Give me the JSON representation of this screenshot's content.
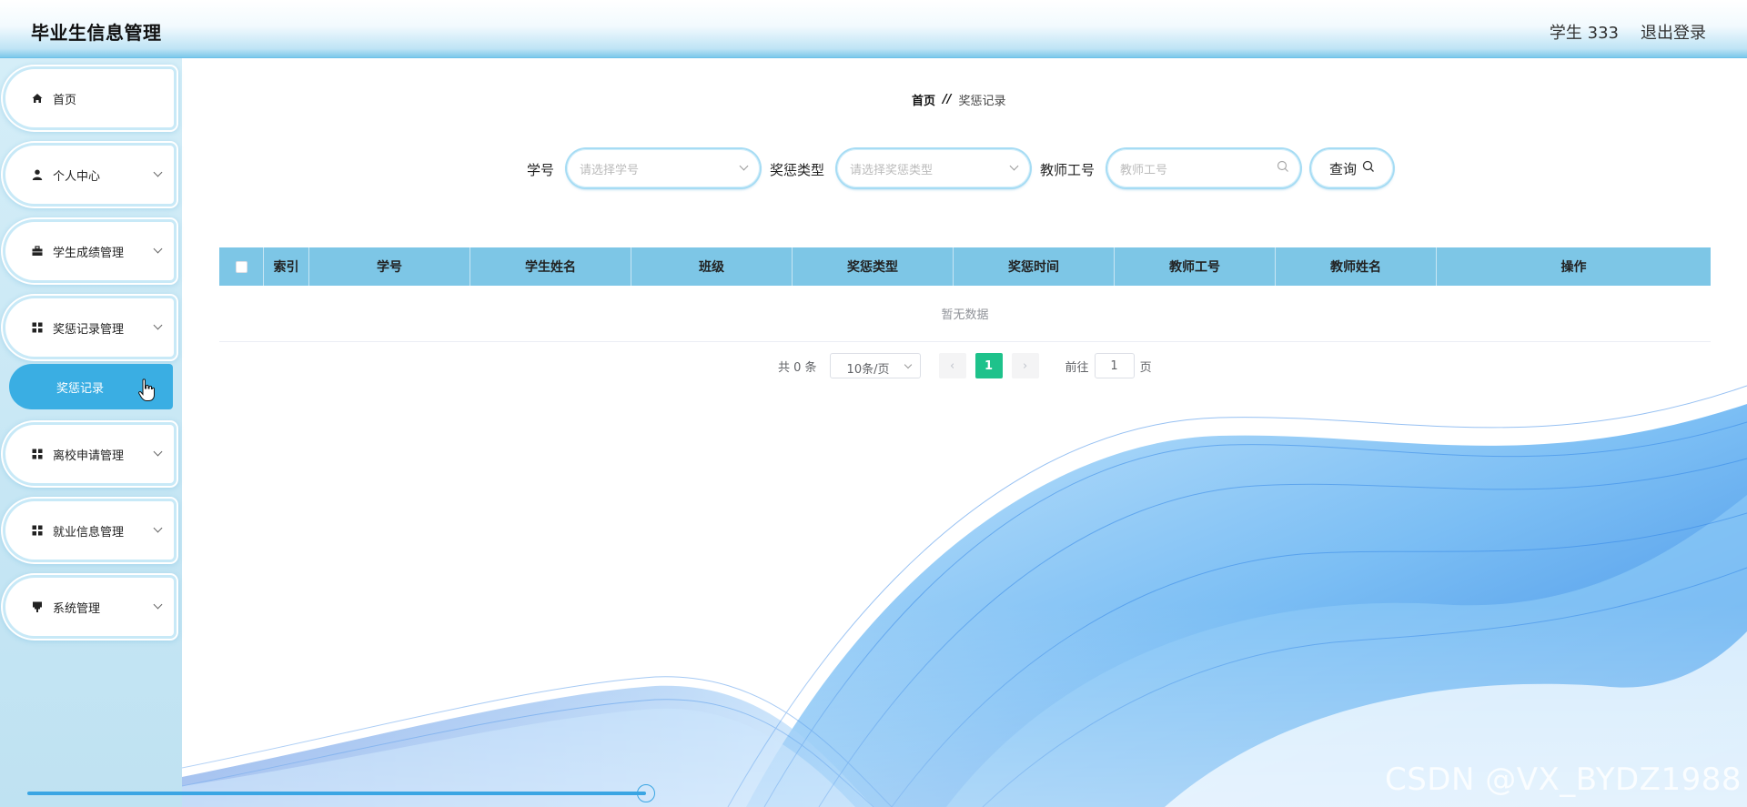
{
  "app": {
    "title": "毕业生信息管理"
  },
  "header": {
    "user_label": "学生 333",
    "logout_label": "退出登录"
  },
  "sidebar": {
    "items": [
      {
        "label": "首页",
        "icon": "home-icon"
      },
      {
        "label": "个人中心",
        "icon": "user-icon"
      },
      {
        "label": "学生成绩管理",
        "icon": "briefcase-icon"
      },
      {
        "label": "奖惩记录管理",
        "icon": "grid-icon"
      },
      {
        "label": "离校申请管理",
        "icon": "grid-icon"
      },
      {
        "label": "就业信息管理",
        "icon": "grid-icon"
      },
      {
        "label": "系统管理",
        "icon": "pin-icon"
      }
    ],
    "active_submenu": {
      "label": "奖惩记录"
    }
  },
  "breadcrumb": {
    "home": "首页",
    "separator": "//",
    "current": "奖惩记录"
  },
  "search": {
    "student_no_label": "学号",
    "student_no_placeholder": "请选择学号",
    "type_label": "奖惩类型",
    "type_placeholder": "请选择奖惩类型",
    "teacher_no_label": "教师工号",
    "teacher_no_placeholder": "教师工号",
    "query_label": "查询"
  },
  "table": {
    "columns": [
      "索引",
      "学号",
      "学生姓名",
      "班级",
      "奖惩类型",
      "奖惩时间",
      "教师工号",
      "教师姓名",
      "操作"
    ],
    "empty_text": "暂无数据"
  },
  "pagination": {
    "total_text": "共 0 条",
    "page_size": "10条/页",
    "current_page": "1",
    "goto_label": "前往",
    "goto_value": "1",
    "page_unit": "页"
  },
  "watermark": "CSDN @VX_BYDZ1988",
  "colors": {
    "accent": "#3aaee3",
    "table_header": "#7dc6e6",
    "active_page": "#1ec28b"
  }
}
